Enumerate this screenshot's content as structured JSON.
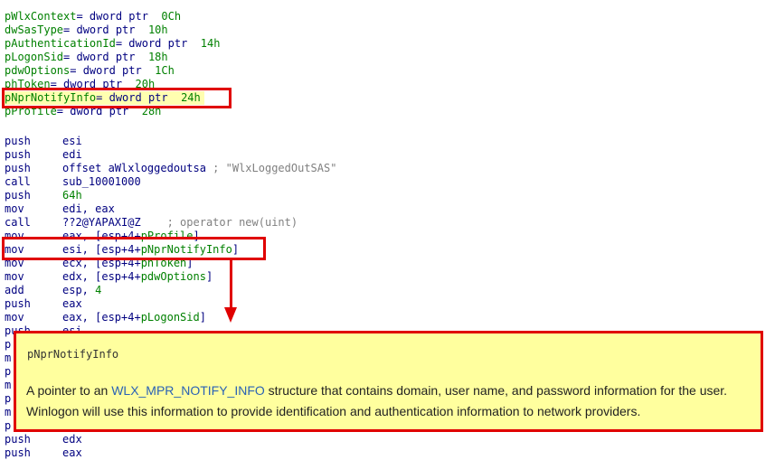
{
  "variables": [
    {
      "name": "pWlxContext",
      "type": "= dword ptr  ",
      "offset": "0Ch"
    },
    {
      "name": "dwSasType",
      "type": "= dword ptr  ",
      "offset": "10h"
    },
    {
      "name": "pAuthenticationId",
      "type": "= dword ptr  ",
      "offset": "14h"
    },
    {
      "name": "pLogonSid",
      "type": "= dword ptr  ",
      "offset": "18h"
    },
    {
      "name": "pdwOptions",
      "type": "= dword ptr  ",
      "offset": "1Ch"
    },
    {
      "name": "phToken",
      "type": "= dword ptr  ",
      "offset": "20h"
    },
    {
      "name": "pNprNotifyInfo",
      "type": "= dword ptr  ",
      "offset": "24h"
    },
    {
      "name": "pProfile",
      "type": "= dword ptr  ",
      "offset": "28h"
    }
  ],
  "instructions": [
    {
      "mnemonic": "push",
      "operand": "esi",
      "comment": ""
    },
    {
      "mnemonic": "push",
      "operand": "edi",
      "comment": ""
    },
    {
      "mnemonic": "push",
      "operand": "offset aWlxloggedoutsa",
      "comment": " ; \"WlxLoggedOutSAS\""
    },
    {
      "mnemonic": "call",
      "operand": "sub_10001000",
      "comment": ""
    },
    {
      "mnemonic": "push",
      "operand": "64h",
      "comment": ""
    },
    {
      "mnemonic": "mov",
      "operand": "edi, eax",
      "comment": ""
    },
    {
      "mnemonic": "call",
      "operand": "??2@YAPAXI@Z",
      "comment": "    ; operator new(uint)"
    },
    {
      "mnemonic": "mov",
      "operand": "eax, [esp+4+pProfile]",
      "comment": ""
    },
    {
      "mnemonic": "mov",
      "operand": "esi, [esp+4+pNprNotifyInfo]",
      "comment": ""
    },
    {
      "mnemonic": "mov",
      "operand": "ecx, [esp+4+phToken]",
      "comment": ""
    },
    {
      "mnemonic": "mov",
      "operand": "edx, [esp+4+pdwOptions]",
      "comment": ""
    },
    {
      "mnemonic": "add",
      "operand": "esp, 4",
      "comment": ""
    },
    {
      "mnemonic": "push",
      "operand": "eax",
      "comment": ""
    },
    {
      "mnemonic": "mov",
      "operand": "eax, [esp+4+pLogonSid]",
      "comment": ""
    },
    {
      "mnemonic": "push",
      "operand": "esi",
      "comment": ""
    },
    {
      "mnemonic": "p",
      "operand": "",
      "comment": ""
    },
    {
      "mnemonic": "m",
      "operand": "",
      "comment": ""
    },
    {
      "mnemonic": "p",
      "operand": "",
      "comment": ""
    },
    {
      "mnemonic": "m",
      "operand": "",
      "comment": ""
    },
    {
      "mnemonic": "p",
      "operand": "",
      "comment": ""
    },
    {
      "mnemonic": "m",
      "operand": "",
      "comment": ""
    },
    {
      "mnemonic": "p",
      "operand": "",
      "comment": ""
    },
    {
      "mnemonic": "push",
      "operand": "edx",
      "comment": ""
    },
    {
      "mnemonic": "push",
      "operand": "eax",
      "comment": ""
    }
  ],
  "tooltip": {
    "title": "pNprNotifyInfo",
    "desc_prefix": "A pointer to an ",
    "desc_link": "WLX_MPR_NOTIFY_INFO",
    "desc_suffix": " structure that contains domain, user name, and password information for the user.",
    "desc_line2": "Winlogon will use this information to provide identification and authentication information to network providers."
  },
  "colors": {
    "highlight_border": "#e00000",
    "tooltip_bg": "#ffff9e",
    "link": "#2a62b5",
    "code_blue": "#000080",
    "code_green": "#008000"
  }
}
